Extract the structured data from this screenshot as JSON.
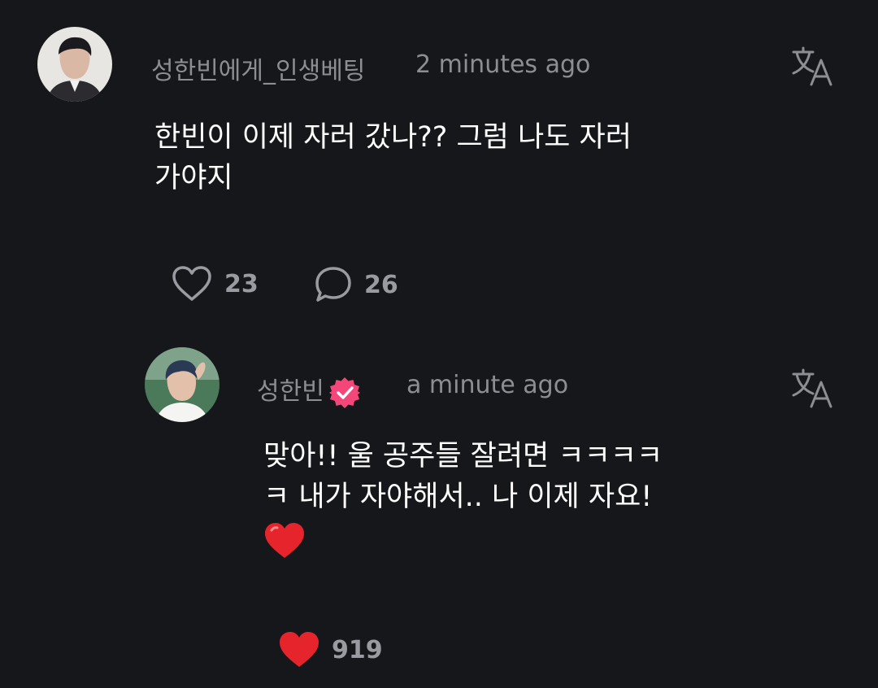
{
  "comment": {
    "username": "성한빈에게_인생베팅",
    "timestamp": "2 minutes ago",
    "lines": [
      "한빈이 이제 자러 갔나?? 그럼 나도 자러",
      "가야지"
    ],
    "like_count": "23",
    "reply_count": "26"
  },
  "reply": {
    "username": "성한빈",
    "timestamp": "a minute ago",
    "lines": [
      "맞아!! 울 공주들 잘려면 ㅋㅋㅋㅋ",
      "ㅋ 내가 자야해서.. 나 이제 자요!"
    ],
    "like_count": "919"
  },
  "icons": {
    "translate": "translate-icon",
    "like": "heart-outline-icon",
    "reply": "speech-bubble-icon",
    "liked": "heart-filled-icon",
    "verified": "verified-badge-icon",
    "emoji": "red-heart-emoji"
  },
  "colors": {
    "background": "#16171b",
    "muted_text": "#8d8e93",
    "liked_red": "#e5242c",
    "verified_pink": "#f5467a"
  }
}
